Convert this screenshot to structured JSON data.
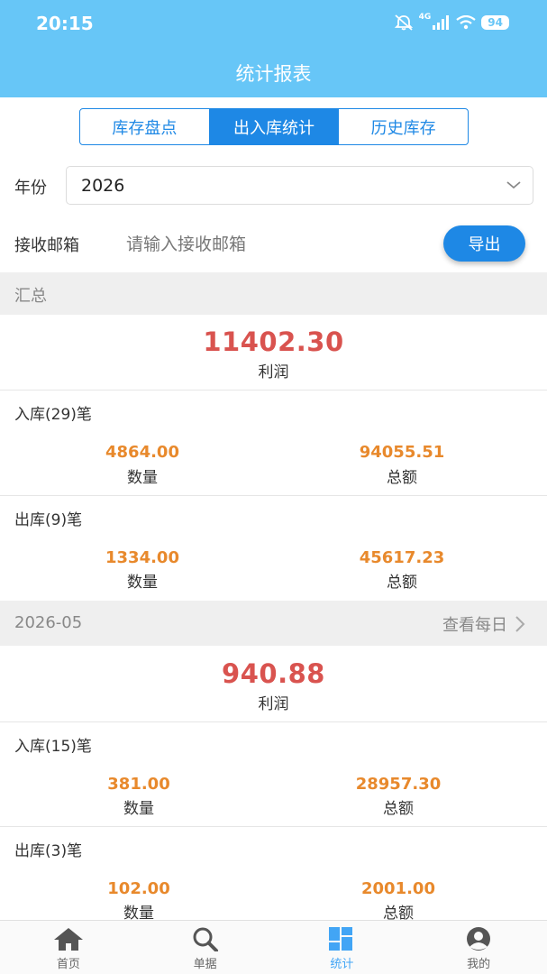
{
  "status_bar": {
    "time": "20:15",
    "network": "4G",
    "battery": "94"
  },
  "header": {
    "title": "统计报表"
  },
  "tabs": [
    {
      "label": "库存盘点",
      "active": false
    },
    {
      "label": "出入库统计",
      "active": true
    },
    {
      "label": "历史库存",
      "active": false
    }
  ],
  "filters": {
    "year_label": "年份",
    "year_value": "2026",
    "email_label": "接收邮箱",
    "email_placeholder": "请输入接收邮箱",
    "export_label": "导出"
  },
  "summary": {
    "title": "汇总",
    "profit_value": "11402.30",
    "profit_label": "利润",
    "inbound": {
      "title": "入库(29)笔",
      "quantity": "4864.00",
      "quantity_label": "数量",
      "amount": "94055.51",
      "amount_label": "总额"
    },
    "outbound": {
      "title": "出库(9)笔",
      "quantity": "1334.00",
      "quantity_label": "数量",
      "amount": "45617.23",
      "amount_label": "总额"
    }
  },
  "month": {
    "title": "2026-05",
    "view_daily": "查看每日",
    "profit_value": "940.88",
    "profit_label": "利润",
    "inbound": {
      "title": "入库(15)笔",
      "quantity": "381.00",
      "quantity_label": "数量",
      "amount": "28957.30",
      "amount_label": "总额"
    },
    "outbound": {
      "title": "出库(3)笔",
      "quantity": "102.00",
      "quantity_label": "数量",
      "amount": "2001.00",
      "amount_label": "总额"
    }
  },
  "bottom_nav": [
    {
      "label": "首页",
      "icon": "home-icon",
      "active": false
    },
    {
      "label": "单据",
      "icon": "search-icon",
      "active": false
    },
    {
      "label": "统计",
      "icon": "grid-icon",
      "active": true
    },
    {
      "label": "我的",
      "icon": "user-icon",
      "active": false
    }
  ],
  "colors": {
    "header": "#67c6f7",
    "accent": "#1e88e5",
    "profit": "#d9534f",
    "stat": "#e8892c",
    "tab_active": "#42a5f5"
  }
}
